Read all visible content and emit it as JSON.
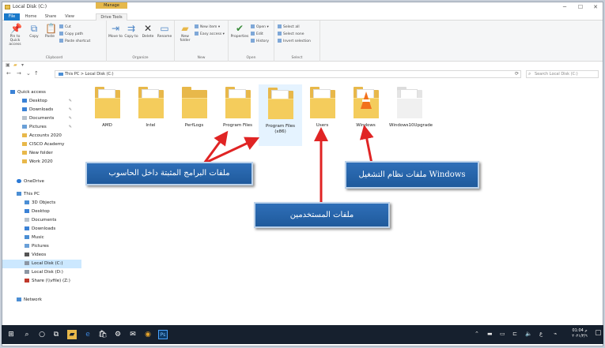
{
  "window": {
    "title": "Local Disk (C:)",
    "context_tab_header": "Manage",
    "controls": [
      "─",
      "☐",
      "✕"
    ]
  },
  "ribbon_tabs": [
    "File",
    "Home",
    "Share",
    "View",
    "Drive Tools"
  ],
  "ribbon": {
    "clipboard": {
      "label": "Clipboard",
      "pin": "Pin to Quick access",
      "copy": "Copy",
      "paste": "Paste",
      "cut": "Cut",
      "copy_path": "Copy path",
      "paste_shortcut": "Paste shortcut"
    },
    "organize": {
      "label": "Organize",
      "move_to": "Move to",
      "copy_to": "Copy to",
      "delete": "Delete",
      "rename": "Rename"
    },
    "new": {
      "label": "New",
      "new_folder": "New folder",
      "new_item": "New item ▾",
      "easy_access": "Easy access ▾"
    },
    "open": {
      "label": "Open",
      "properties": "Properties",
      "open": "Open ▾",
      "edit": "Edit",
      "history": "History"
    },
    "select": {
      "label": "Select",
      "select_all": "Select all",
      "select_none": "Select none",
      "invert": "Invert selection"
    }
  },
  "address": {
    "path": "This PC  >  Local Disk (C:)",
    "search_placeholder": "Search Local Disk (C:)"
  },
  "nav_pane": {
    "quick_access": "Quick access",
    "items": [
      {
        "label": "Desktop",
        "pinned": true
      },
      {
        "label": "Downloads",
        "pinned": true
      },
      {
        "label": "Documents",
        "pinned": true
      },
      {
        "label": "Pictures",
        "pinned": true
      },
      {
        "label": "Accounts 2020",
        "pinned": false
      },
      {
        "label": "CISCO Academy",
        "pinned": false
      },
      {
        "label": "New folder",
        "pinned": false
      },
      {
        "label": "Work 2020",
        "pinned": false
      }
    ],
    "onedrive": "OneDrive",
    "this_pc": "This PC",
    "pc_items": [
      "3D Objects",
      "Desktop",
      "Documents",
      "Downloads",
      "Music",
      "Pictures",
      "Videos",
      "Local Disk (C:)",
      "Local Disk (D:)",
      "Share (\\\\vfile) (Z:)"
    ],
    "network": "Network"
  },
  "folders": [
    "AMD",
    "Intel",
    "PerfLogs",
    "Program Files",
    "Program Files (x86)",
    "Users",
    "Windows",
    "Windows10Upgrade"
  ],
  "callouts": {
    "program_files": "ملفات البرامج المثبتة داخل الحاسوب",
    "users": "ملفات المستخدمين",
    "windows": "ملفات نظام التشغيل Windows"
  },
  "taskbar": {
    "clock_time": "01:04 م",
    "clock_date": "٢٠٢١/٣/٦"
  },
  "colors": {
    "accent": "#1979ca",
    "callout": "#2a66ad",
    "arrow": "#e02424",
    "taskbar": "#16202e"
  }
}
